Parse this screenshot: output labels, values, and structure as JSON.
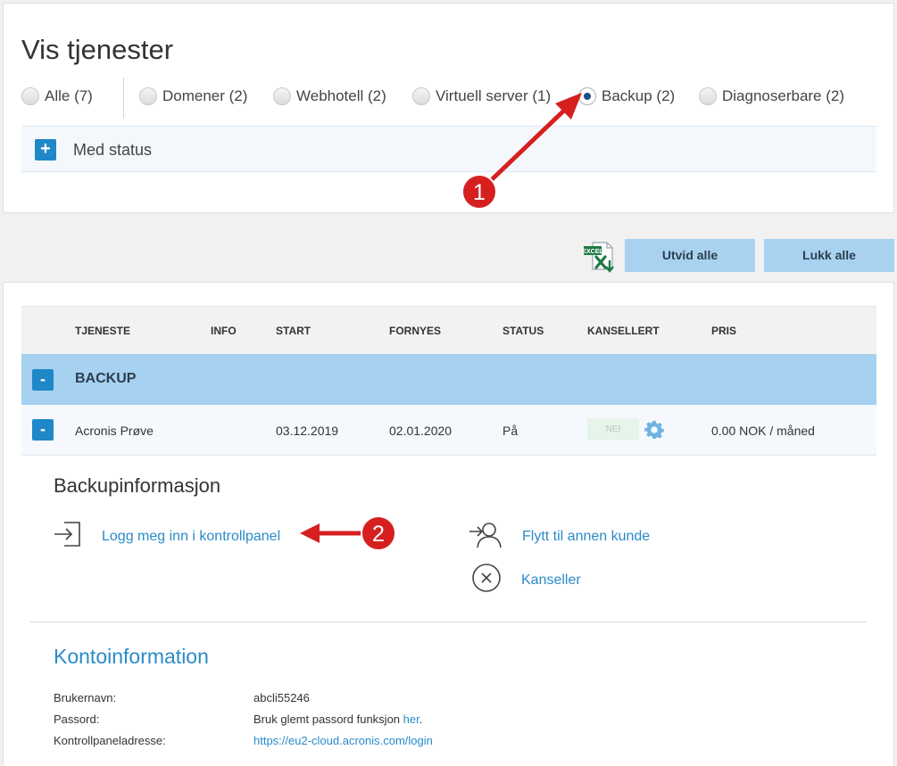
{
  "header": {
    "title": "Vis tjenester"
  },
  "filters": [
    {
      "label": "Alle (7)",
      "checked": false
    },
    {
      "label": "Domener (2)",
      "checked": false
    },
    {
      "label": "Webhotell (2)",
      "checked": false
    },
    {
      "label": "Virtuell server (1)",
      "checked": false
    },
    {
      "label": "Backup (2)",
      "checked": true
    },
    {
      "label": "Diagnoserbare (2)",
      "checked": false
    }
  ],
  "status_filter": {
    "toggle": "+",
    "label": "Med status"
  },
  "toolbar": {
    "excel_icon": "excel-export-icon",
    "expand_all": "Utvid alle",
    "collapse_all": "Lukk alle"
  },
  "table": {
    "columns": [
      "TJENESTE",
      "INFO",
      "START",
      "FORNYES",
      "STATUS",
      "KANSELLERT",
      "PRIS"
    ],
    "group": {
      "toggle": "-",
      "label": "BACKUP"
    },
    "row": {
      "toggle": "-",
      "service": "Acronis Prøve",
      "start": "03.12.2019",
      "renew": "02.01.2020",
      "status": "På",
      "cancelled": "NEI",
      "price": "0.00 NOK / måned"
    }
  },
  "details": {
    "title": "Backupinformasjon",
    "login_link": "Logg meg inn i kontrollpanel",
    "move_link": "Flytt til annen kunde",
    "cancel_link": "Kanseller"
  },
  "account": {
    "title": "Kontoinformation",
    "username_label": "Brukernavn:",
    "username": "abcli55246",
    "password_label": "Passord:",
    "password_text": "Bruk glemt passord funksjon",
    "password_link": "her",
    "password_suffix": ".",
    "panel_label": "Kontrollpaneladresse:",
    "panel_url": "https://eu2-cloud.acronis.com/login"
  },
  "annotations": {
    "marker1": "1",
    "marker2": "2",
    "color": "#d62020"
  }
}
